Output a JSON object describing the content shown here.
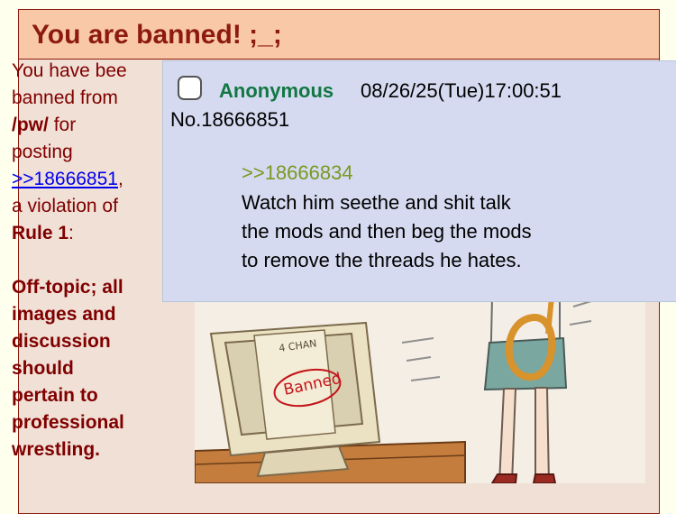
{
  "ban": {
    "title": "You are banned! ;_;",
    "line1": "You have bee",
    "line2": "banned from",
    "board": "/pw/",
    "for_text": "for",
    "posting_text": "posting",
    "post_link": ">>18666851",
    "comma": ",",
    "violation_line": "a violation of",
    "rule_label": "Rule 1",
    "colon": ":",
    "reason_lines": [
      "Off-topic; all",
      "images and",
      "discussion",
      "should",
      "pertain to",
      "professional",
      "wrestling."
    ],
    "image": {
      "monitor_text": "4 CHAN",
      "stamp_text": "Banned"
    }
  },
  "preview": {
    "name": "Anonymous",
    "datetime": "08/26/25(Tue)17:00:51",
    "post_number": "No.18666851",
    "quote_link": ">>18666834",
    "comment_lines": [
      "Watch him seethe and shit talk",
      "the mods and then beg the mods",
      "to remove the threads he hates."
    ]
  },
  "colors": {
    "header_bg": "#f9c9a7",
    "title_text": "#8c1a0f",
    "body_bg": "#f0e0d6",
    "preview_bg": "#d6daf0",
    "name_green": "#117743",
    "greentext": "#789922",
    "link_blue": "#0000ee"
  }
}
